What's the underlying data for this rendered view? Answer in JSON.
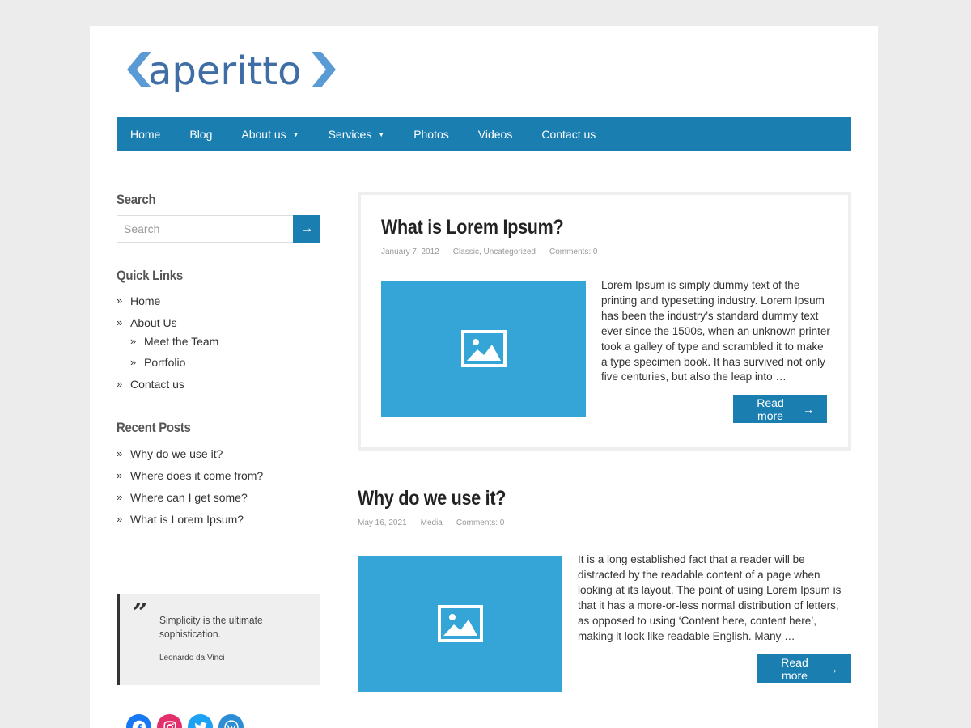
{
  "logo": {
    "text": "aperitto"
  },
  "nav": {
    "items": [
      {
        "label": "Home",
        "has_submenu": false
      },
      {
        "label": "Blog",
        "has_submenu": false
      },
      {
        "label": "About us",
        "has_submenu": true
      },
      {
        "label": "Services",
        "has_submenu": true
      },
      {
        "label": "Photos",
        "has_submenu": false
      },
      {
        "label": "Videos",
        "has_submenu": false
      },
      {
        "label": "Contact us",
        "has_submenu": false
      }
    ]
  },
  "sidebar": {
    "search": {
      "title": "Search",
      "placeholder": "Search",
      "value": "",
      "button_label": "→"
    },
    "quick_links": {
      "title": "Quick Links",
      "items": [
        "Home",
        "About Us",
        "Contact us"
      ],
      "about_children": [
        "Meet the Team",
        "Portfolio"
      ]
    },
    "recent_posts": {
      "title": "Recent Posts",
      "items": [
        "Why do we use it?",
        "Where does it come from?",
        "Where can I get some?",
        "What is Lorem Ipsum?"
      ]
    },
    "quote": {
      "mark": "”",
      "text": "Simplicity is the ultimate sophistication.",
      "author": "Leonardo da Vinci"
    },
    "social": [
      {
        "name": "facebook",
        "glyph": "f",
        "color": "#1877f2"
      },
      {
        "name": "instagram",
        "glyph": "◎",
        "color": "#e1306c"
      },
      {
        "name": "twitter",
        "glyph": "t",
        "color": "#1da1f2"
      },
      {
        "name": "wordpress",
        "glyph": "W",
        "color": "#2c8dd4"
      }
    ]
  },
  "posts": [
    {
      "title": "What is Lorem Ipsum?",
      "date": "January 7, 2012",
      "categories": "Classic, Uncategorized",
      "comments": "Comments: 0",
      "excerpt": "Lorem Ipsum is simply dummy text of the printing and typesetting industry. Lorem Ipsum has been the industry’s standard dummy text ever since the 1500s, when an unknown printer took a galley of type and scrambled it to make a type specimen book. It has survived not only five centuries, but also the leap into …",
      "read_more": "Read more",
      "arrow": "→"
    },
    {
      "title": "Why do we use it?",
      "date": "May 16, 2021",
      "categories": "Media",
      "comments": "Comments: 0",
      "excerpt": "It is a long established fact that a reader will be distracted by the readable content of a page when looking at its layout. The point of using Lorem Ipsum is that it has a more-or-less normal distribution of letters, as opposed to using ‘Content here, content here’, making it look like readable English. Many …",
      "read_more": "Read more",
      "arrow": "→"
    }
  ],
  "colors": {
    "accent": "#1a7eb0",
    "thumb": "#34a5d6",
    "logo": "#3f6ea6",
    "logo_chevron": "#5b9bd5"
  }
}
